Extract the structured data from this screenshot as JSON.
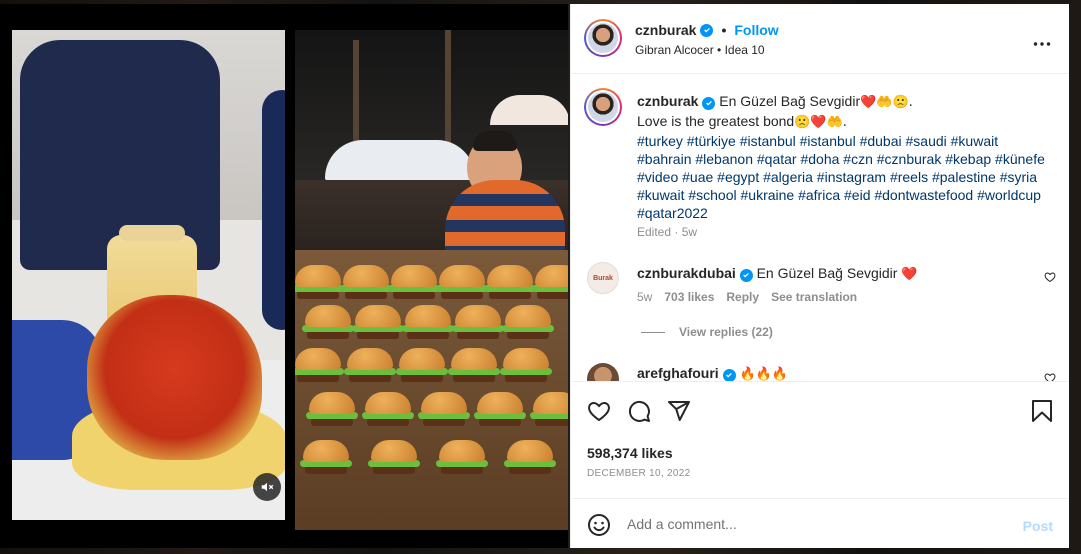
{
  "post": {
    "username": "cznburak",
    "follow_label": "Follow",
    "subtitle": "Gibran Alcocer • Idea 10",
    "caption": {
      "user": "cznburak",
      "line1": "En Güzel Bağ Sevgidir",
      "line1_emoji": "❤️🤲🙁.",
      "line2": "Love is the greatest bond",
      "line2_emoji": "🙁❤️🤲.",
      "hashtags": "#turkey #türkiye #istanbul #istanbul #dubai #saudi #kuwait #bahrain #lebanon #qatar #doha #czn #cznburak #kebap #künefe #video #uae #egypt #algeria #instagram #reels #palestine #syria #kuwait #school #ukraine #africa #eid #dontwastefood #worldcup #qatar2022",
      "edited": "Edited · 5w"
    },
    "comments": [
      {
        "user": "cznburakdubai",
        "text": "En Güzel Bağ Sevgidir",
        "emoji": "❤️",
        "avatar_text": "Burak",
        "age": "5w",
        "likes": "703 likes",
        "reply_label": "Reply",
        "translate_label": "See translation",
        "view_replies": "View replies (22)"
      },
      {
        "user": "arefghafouri",
        "emoji": "🔥🔥🔥"
      }
    ],
    "likes": "598,374 likes",
    "date": "DECEMBER 10, 2022",
    "comment_placeholder": "Add a comment...",
    "post_label": "Post"
  },
  "icons": {
    "verified": "verified-badge-icon",
    "more": "more-options-icon",
    "like": "heart-icon",
    "comment": "comment-icon",
    "share": "share-icon",
    "save": "bookmark-icon",
    "emoji": "emoji-icon",
    "mute": "muted-speaker-icon"
  },
  "colors": {
    "accent": "#0095f6",
    "hashtag": "#00376b",
    "muted": "#8e8e8e",
    "post_disabled": "#b3dbff"
  }
}
